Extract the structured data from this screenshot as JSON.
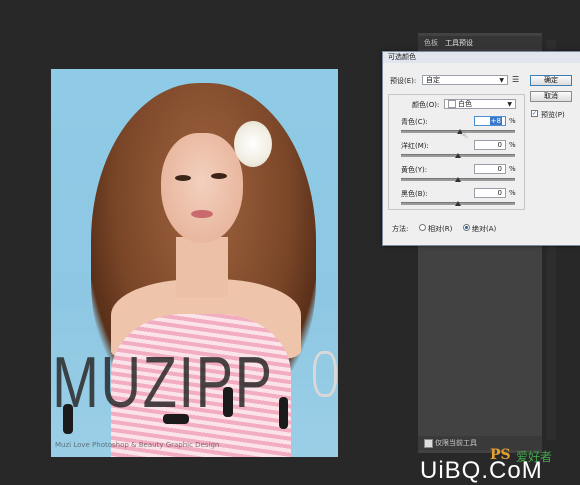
{
  "dialog": {
    "title": "可选颜色",
    "preset_label": "预设(E):",
    "preset_value": "自定",
    "colors_label": "颜色(O):",
    "colors_value": "白色",
    "ok": "确定",
    "cancel": "取消",
    "preview_label": "预览(P)",
    "preview_checked": true,
    "sliders": [
      {
        "label": "青色(C):",
        "value": "+8",
        "level": 0.52
      },
      {
        "label": "洋红(M):",
        "value": "0",
        "level": 0.5
      },
      {
        "label": "黄色(Y):",
        "value": "0",
        "level": 0.5
      },
      {
        "label": "黑色(B):",
        "value": "0",
        "level": 0.5
      }
    ],
    "percent_sign": "%",
    "method_label": "方法:",
    "relative_label": "相对(R)",
    "absolute_label": "绝对(A)",
    "method_selected": "absolute"
  },
  "panel": {
    "tab_swatches": "色板",
    "tab_tool_presets": "工具预设",
    "current_tool_only": "仅限当前工具"
  },
  "canvas": {
    "watermark": "MUZIPP",
    "watermark_sub": "Muzi Love Photoshop & Beauty Graphic Design"
  },
  "logo": {
    "ps": "PS",
    "cn": "爱好者",
    "main": "UiBQ.CoM"
  }
}
